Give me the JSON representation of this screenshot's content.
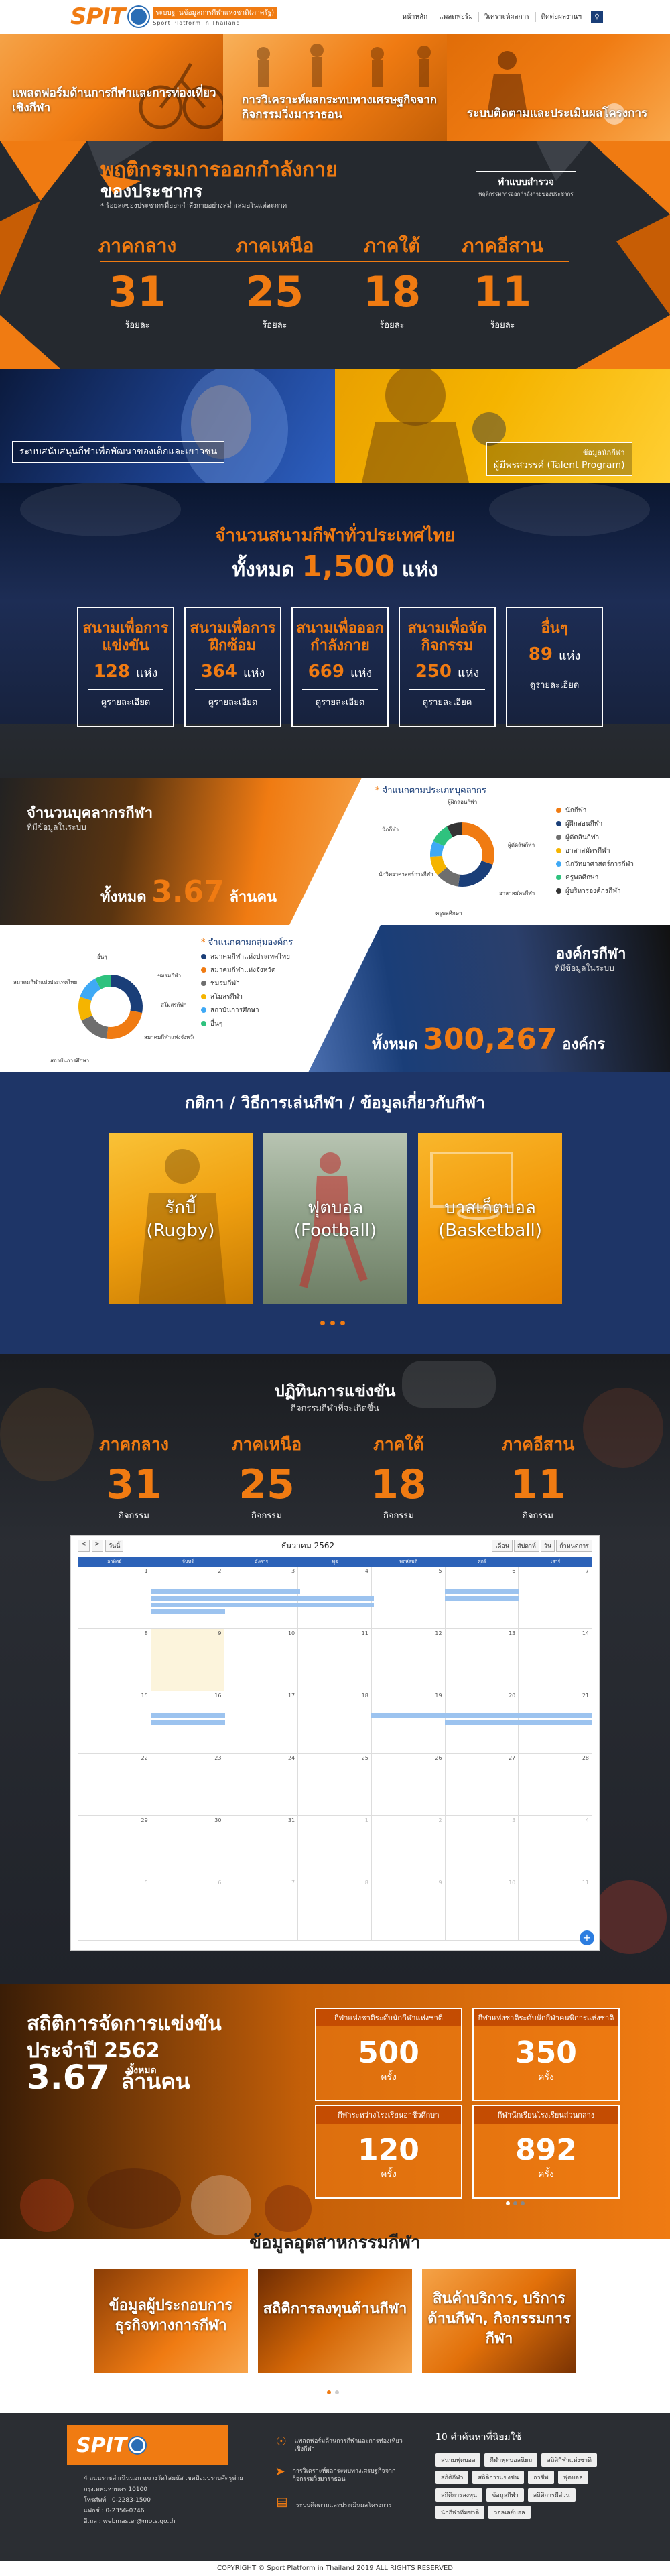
{
  "header": {
    "logo_mark": "SPIT",
    "logo_line1": "ระบบฐานข้อมูลการกีฬาแห่งชาติ(ภาครัฐ)",
    "logo_line2": "Sport Platform in Thailand",
    "nav": [
      "หน้าหลัก",
      "แพลตฟอร์ม",
      "วิเคราะห์ผลการ",
      "ติดต่อผลงานฯ"
    ],
    "search_icon": "search-icon"
  },
  "hero_tiles": [
    {
      "label": "แพลตฟอร์มด้านการกีฬาและการท่องเที่ยวเชิงกีฬา"
    },
    {
      "label": "การวิเคราะห์ผลกระทบทางเศรษฐกิจจากกิจกรรมวิ่งมาราธอน"
    },
    {
      "label": "ระบบติดตามและประเมินผลโครงการ"
    }
  ],
  "behaviour": {
    "title": "พฤติกรรมการออกกำลังกาย",
    "subtitle": "ของประชากร",
    "note": "* ร้อยละของประชากรที่ออกกำลังกายอย่างสม่ำเสมอในแต่ละภาค",
    "button_title": "ทำแบบสำรวจ",
    "button_sub": "พฤติกรรมการออกกำลังกายของประชากร",
    "regions": [
      {
        "name": "ภาคกลาง",
        "value": "31",
        "unit": "ร้อยละ"
      },
      {
        "name": "ภาคเหนือ",
        "value": "25",
        "unit": "ร้อยละ"
      },
      {
        "name": "ภาคใต้",
        "value": "18",
        "unit": "ร้อยละ"
      },
      {
        "name": "ภาคอีสาน",
        "value": "11",
        "unit": "ร้อยละ"
      }
    ]
  },
  "programs": {
    "left": "ระบบสนับสนุนกีฬาเพื่อพัฒนาของเด็กและเยาวชน",
    "right_top": "ข้อมูลนักกีฬา",
    "right": "ผู้มีพรสวรรค์ (Talent Program)"
  },
  "stadiums": {
    "title": "จำนวนสนามกีฬาทั่วประเทศไทย",
    "total_prefix": "ทั้งหมด",
    "total": "1,500",
    "total_unit": "แห่ง",
    "boxes": [
      {
        "label": "สนามเพื่อการแข่งขัน",
        "value": "128",
        "unit": "แห่ง",
        "link": "ดูรายละเอียด"
      },
      {
        "label": "สนามเพื่อการฝึกซ้อม",
        "value": "364",
        "unit": "แห่ง",
        "link": "ดูรายละเอียด"
      },
      {
        "label": "สนามเพื่อออกกำลังกาย",
        "value": "669",
        "unit": "แห่ง",
        "link": "ดูรายละเอียด"
      },
      {
        "label": "สนามเพื่อจัดกิจกรรม",
        "value": "250",
        "unit": "แห่ง",
        "link": "ดูรายละเอียด"
      },
      {
        "label": "อื่นๆ",
        "value": "89",
        "unit": "แห่ง",
        "link": "ดูรายละเอียด"
      }
    ]
  },
  "personnel": {
    "title": "จำนวนบุคลากรกีฬา",
    "subtitle": "ที่มีข้อมูลในระบบ",
    "total_prefix": "ทั้งหมด",
    "total": "3.67",
    "total_unit": "ล้านคน",
    "chart_title": "จำแนกตามประเภทบุคลากร",
    "legend": [
      {
        "name": "นักกีฬา",
        "color": "#f07b12"
      },
      {
        "name": "ผู้ฝึกสอนกีฬา",
        "color": "#1a3e78"
      },
      {
        "name": "ผู้ตัดสินกีฬา",
        "color": "#6e6e6e"
      },
      {
        "name": "อาสาสมัครกีฬา",
        "color": "#f5b400"
      },
      {
        "name": "นักวิทยาศาสตร์การกีฬา",
        "color": "#3fa9f5"
      },
      {
        "name": "ครูพลศึกษา",
        "color": "#2ec27e"
      },
      {
        "name": "ผู้บริหารองค์กรกีฬา",
        "color": "#333333"
      }
    ],
    "callouts": [
      "ผู้ฝึกสอนกีฬา",
      "นักกีฬา",
      "ผู้ตัดสินกีฬา",
      "นักวิทยาศาสตร์การกีฬา",
      "อาสาสมัครกีฬา",
      "ครูพลศึกษา"
    ]
  },
  "organizations": {
    "title": "องค์กรกีฬา",
    "subtitle": "ที่มีข้อมูลในระบบ",
    "total_prefix": "ทั้งหมด",
    "total": "300,267",
    "total_unit": "องค์กร",
    "chart_title": "จำแนกตามกลุ่มองค์กร",
    "legend": [
      {
        "name": "สมาคมกีฬาแห่งประเทศไทย",
        "color": "#1a3e78"
      },
      {
        "name": "สมาคมกีฬาแห่งจังหวัด",
        "color": "#f07b12"
      },
      {
        "name": "ชมรมกีฬา",
        "color": "#6e6e6e"
      },
      {
        "name": "สโมสรกีฬา",
        "color": "#f5b400"
      },
      {
        "name": "สถาบันการศึกษา",
        "color": "#3fa9f5"
      },
      {
        "name": "อื่นๆ",
        "color": "#2ec27e"
      }
    ],
    "callouts": [
      "อื่นๆ",
      "ชมรมกีฬา",
      "สมาคมกีฬาแห่งประเทศไทย",
      "สโมสรกีฬา",
      "สมาคมกีฬาแห่งจังหวัด",
      "สถาบันการศึกษา"
    ]
  },
  "rules": {
    "title": "กติกา / วิธีการเล่นกีฬา / ข้อมูลเกี่ยวกับกีฬา",
    "cards": [
      {
        "name": "รักบี้",
        "en": "(Rugby)"
      },
      {
        "name": "ฟุตบอล",
        "en": "(Football)"
      },
      {
        "name": "บาสเก็ตบอล",
        "en": "(Basketball)"
      }
    ]
  },
  "competitions": {
    "title": "ปฏิทินการแข่งขัน",
    "subtitle": "กิจกรรมกีฬาที่จะเกิดขึ้น",
    "regions": [
      {
        "name": "ภาคกลาง",
        "value": "31",
        "unit": "กิจกรรม"
      },
      {
        "name": "ภาคเหนือ",
        "value": "25",
        "unit": "กิจกรรม"
      },
      {
        "name": "ภาคใต้",
        "value": "18",
        "unit": "กิจกรรม"
      },
      {
        "name": "ภาคอีสาน",
        "value": "11",
        "unit": "กิจกรรม"
      }
    ],
    "calendar": {
      "prev": "<",
      "next": ">",
      "today_btn": "วันนี้",
      "month": "ธันวาคม 2562",
      "views": [
        "เดือน",
        "สัปดาห์",
        "วัน",
        "กำหนดการ"
      ],
      "weekdays": [
        "อาทิตย์",
        "จันทร์",
        "อังคาร",
        "พุธ",
        "พฤหัสบดี",
        "ศุกร์",
        "เสาร์"
      ],
      "days": [
        "1",
        "2",
        "3",
        "4",
        "5",
        "6",
        "7",
        "8",
        "9",
        "10",
        "11",
        "12",
        "13",
        "14",
        "15",
        "16",
        "17",
        "18",
        "19",
        "20",
        "21",
        "22",
        "23",
        "24",
        "25",
        "26",
        "27",
        "28",
        "29",
        "30",
        "31",
        "1",
        "2",
        "3",
        "4",
        "5",
        "6",
        "7",
        "8",
        "9",
        "10",
        "11"
      ],
      "add": "+"
    }
  },
  "stats": {
    "title1": "สถิติการจัดการแข่งขัน",
    "title2": "ประจำปี 2562",
    "prefix": "ทั้งหมด",
    "total": "3.67",
    "unit": "ล้านคน",
    "cards": [
      {
        "head": "กีฬาแห่งชาติระดับนักกีฬาแห่งชาติ",
        "value": "500",
        "unit": "ครั้ง"
      },
      {
        "head": "กีฬาแห่งชาติระดับนักกีฬาคนพิการแห่งชาติ",
        "value": "350",
        "unit": "ครั้ง"
      },
      {
        "head": "กีฬาระหว่างโรงเรียนอาชีวศึกษา",
        "value": "120",
        "unit": "ครั้ง"
      },
      {
        "head": "กีฬานักเรียนโรงเรียนส่วนกลาง",
        "value": "892",
        "unit": "ครั้ง"
      }
    ]
  },
  "industry": {
    "title": "ข้อมูลอุตสาหกรรมกีฬา",
    "cards": [
      {
        "label": "ข้อมูลผู้ประกอบการธุรกิจทางการกีฬา"
      },
      {
        "label": "สถิติการลงทุนด้านกีฬา"
      },
      {
        "label": "สินค้าบริการ, บริการด้านกีฬา, กิจกรรมการกีฬา"
      }
    ]
  },
  "footer": {
    "logo_mark": "SPIT",
    "address": "4 ถนนราชดำเนินนอก แขวงวัดโสมนัส เขตป้อมปราบศัตรูพ่าย กรุงเทพมหานคร 10100",
    "tel": "โทรศัพท์ : 0-2283-1500",
    "fax": "แฟกซ์ : 0-2356-0746",
    "email": "อีเมล : webmaster@mots.go.th",
    "links": [
      {
        "label": "แพลตฟอร์มด้านการกีฬาและการท่องเที่ยวเชิงกีฬา",
        "icon": "globe-icon"
      },
      {
        "label": "การวิเคราะห์ผลกระทบทางเศรษฐกิจจากกิจกรรมวิ่งมาราธอน",
        "icon": "running-icon"
      },
      {
        "label": "ระบบติดตามและประเมินผลโครงการ",
        "icon": "chart-icon"
      }
    ],
    "tags_title": "10 คำค้นหาที่นิยมใช้",
    "tags": [
      "สนามฟุตบอล",
      "กีฬาฟุตบอลนิยม",
      "สถิติกีฬาแห่งชาติ",
      "สถิติกีฬา",
      "สถิติการแข่งขัน",
      "อาชีพ",
      "ฟุตบอล",
      "สถิติการลงทุน",
      "ข้อมูลกีฬา",
      "สถิติการมีส่วน",
      "นักกีฬาทีมชาติ",
      "วอลเลย์บอล"
    ],
    "copyright": "COPYRIGHT © Sport Platform in Thailand 2019 ALL RIGHTS RESERVED"
  }
}
